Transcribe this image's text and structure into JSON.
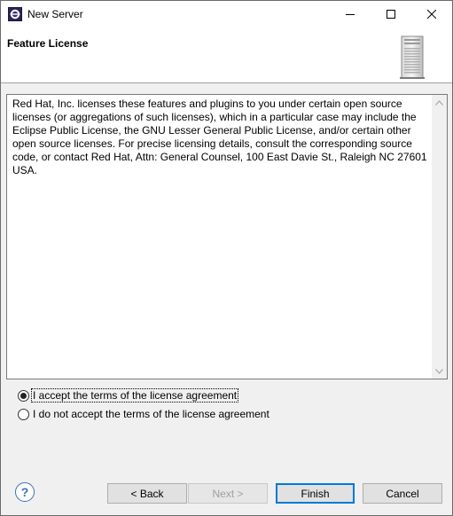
{
  "window": {
    "title": "New Server"
  },
  "banner": {
    "page_title": "Feature License",
    "graphic_icon": "server-tower-icon"
  },
  "license": {
    "text": "Red Hat, Inc. licenses these features and plugins to you under certain open source licenses (or aggregations of such licenses), which in a particular case may include the Eclipse Public License, the GNU Lesser General Public License, and/or certain other open source licenses. For precise licensing details, consult the corresponding source code, or contact Red Hat, Attn: General Counsel, 100 East Davie St., Raleigh NC 27601 USA."
  },
  "options": {
    "accept_label": "I accept the terms of the license agreement",
    "decline_label": "I do not accept the terms of the license agreement",
    "selected": "accept"
  },
  "buttons": {
    "help": "?",
    "back": "< Back",
    "next": "Next >",
    "finish": "Finish",
    "cancel": "Cancel"
  },
  "colors": {
    "accent": "#0078d7",
    "help_icon": "#3c6fb4"
  }
}
